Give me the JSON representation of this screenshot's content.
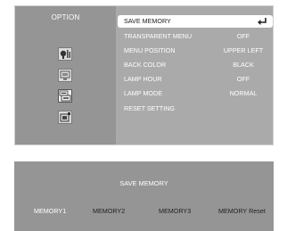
{
  "osd": {
    "title": "OPTION",
    "tabs": [
      {
        "icon": "picture-adjust-icon",
        "active": false
      },
      {
        "icon": "display-icon",
        "active": false
      },
      {
        "icon": "option-icon",
        "active": true
      },
      {
        "icon": "input-icon",
        "active": false
      }
    ],
    "menu": [
      {
        "label": "SAVE MEMORY",
        "value": "",
        "selected": true
      },
      {
        "label": "TRANSPARENT MENU",
        "value": "OFF"
      },
      {
        "label": "MENU POSITION",
        "value": "UPPER LEFT"
      },
      {
        "label": "BACK COLOR",
        "value": "BLACK"
      },
      {
        "label": "LAMP HOUR",
        "value": "OFF"
      },
      {
        "label": "LAMP MODE",
        "value": "NORMAL"
      },
      {
        "label": "RESET SETTING",
        "value": ""
      }
    ],
    "selected_icon": "enter-icon"
  },
  "save_memory": {
    "title": "SAVE MEMORY",
    "options": [
      "MEMORY1",
      "MEMORY2",
      "MEMORY3",
      "MEMORY Reset"
    ],
    "selected_index": 0
  },
  "colors": {
    "panel_bg": "#aaaaaa",
    "sidebar_bg": "#959595",
    "highlight_bg": "#ffffff",
    "text_light": "#ffffff",
    "text_dark": "#222222"
  }
}
